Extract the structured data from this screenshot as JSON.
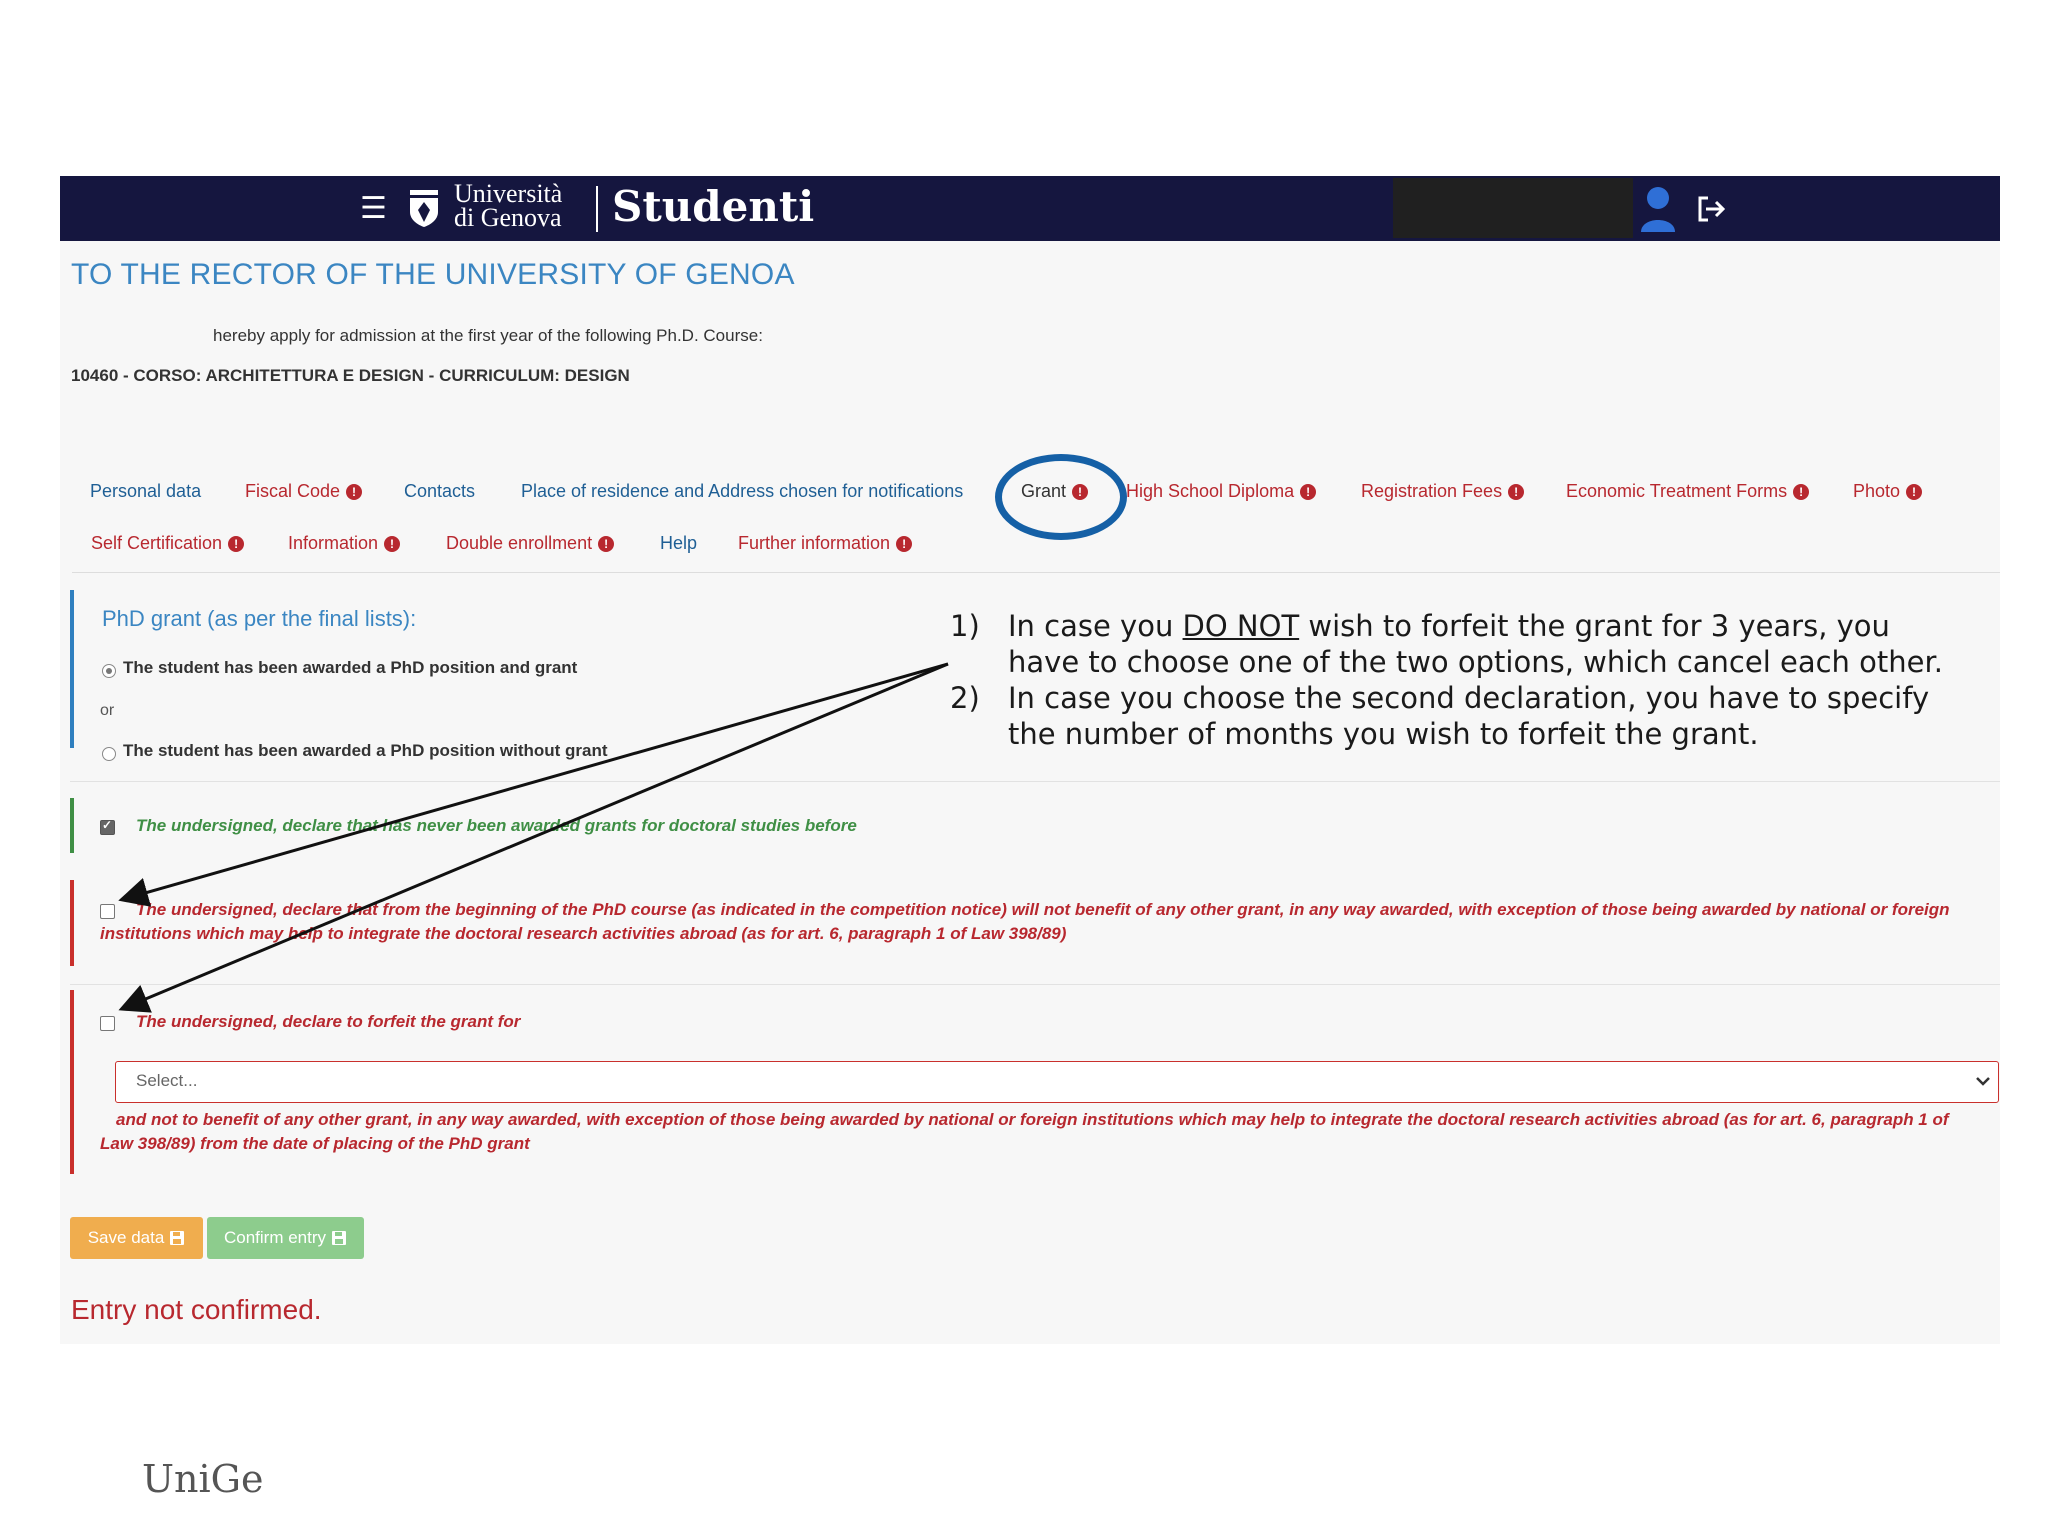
{
  "header": {
    "menu_icon": "hamburger-icon",
    "university_line1": "Università",
    "university_line2": "di Genova",
    "app_name": "Studenti",
    "user_icon": "user-icon",
    "logout_icon": "logout-icon"
  },
  "page": {
    "title": "TO THE RECTOR OF THE UNIVERSITY OF GENOA",
    "apply_text": "hereby apply for admission at the first year of the following Ph.D. Course:",
    "course": "10460 - CORSO: ARCHITETTURA E DESIGN - CURRICULUM: DESIGN"
  },
  "tabs": [
    {
      "label": "Personal data",
      "alert": false
    },
    {
      "label": "Fiscal Code",
      "alert": true
    },
    {
      "label": "Contacts",
      "alert": false
    },
    {
      "label": "Place of residence and Address chosen for notifications",
      "alert": false
    },
    {
      "label": "Grant",
      "alert": true,
      "active": true
    },
    {
      "label": "High School Diploma",
      "alert": true
    },
    {
      "label": "Registration Fees",
      "alert": true
    },
    {
      "label": "Economic Treatment Forms",
      "alert": true
    },
    {
      "label": "Photo",
      "alert": true
    },
    {
      "label": "Self Certification",
      "alert": true
    },
    {
      "label": "Information",
      "alert": true
    },
    {
      "label": "Double enrollment",
      "alert": true
    },
    {
      "label": "Help",
      "alert": false
    },
    {
      "label": "Further information",
      "alert": true
    }
  ],
  "alert_glyph": "!",
  "grant_section": {
    "title": "PhD grant (as per the final lists):",
    "option1": "The student has been awarded a PhD position and grant",
    "option1_selected": true,
    "or": "or",
    "option2": "The student has been awarded a PhD position without grant",
    "option2_selected": false
  },
  "declarations": {
    "never_awarded": "The undersigned, declare that has never been awarded grants for doctoral studies before",
    "never_awarded_checked": true,
    "no_other_grant": "The undersigned, declare that from the beginning of the PhD course (as indicated in the competition notice) will not benefit of any other grant, in any way awarded, with exception of those being awarded by national or foreign institutions which may help to integrate the doctoral research activities abroad (as for art. 6, paragraph 1 of Law 398/89)",
    "no_other_grant_checked": false,
    "forfeit": "The undersigned, declare to forfeit the grant for",
    "forfeit_checked": false,
    "forfeit_select": "Select...",
    "forfeit_tail": "and not to benefit of any other grant, in any way awarded, with exception of those being awarded by national or foreign institutions which may help to integrate the doctoral research activities abroad (as for art. 6, paragraph 1 of Law 398/89) from the date of placing of the PhD grant"
  },
  "buttons": {
    "save": "Save data",
    "confirm": "Confirm entry",
    "icon": "floppy-disk-icon"
  },
  "status": "Entry not confirmed.",
  "instructions": {
    "item1_num": "1)",
    "item1_pre": "In case you ",
    "item1_emph": "DO NOT",
    "item1_post": " wish to forfeit the grant for 3 years, you have to choose one of the two options, which cancel each other.",
    "item2_num": "2)",
    "item2_text": "In case you choose the second declaration, you have to specify the number of months you wish to forfeit the grant."
  },
  "footer": {
    "logo": "UniGe"
  },
  "colors": {
    "navbar": "#15163f",
    "link_blue": "#1f5f95",
    "alert_red": "#b8282f",
    "save": "#f0ad4e",
    "confirm": "#8dcc8d",
    "circle": "#1560a6"
  }
}
